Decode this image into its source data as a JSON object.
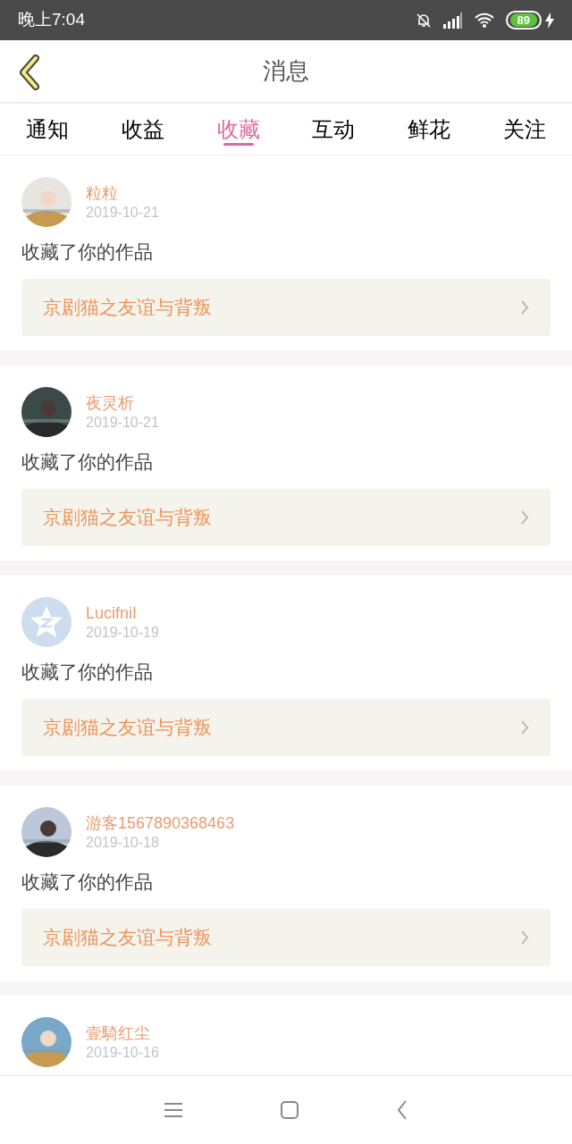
{
  "status_bar": {
    "time": "晚上7:04",
    "battery": "89"
  },
  "header": {
    "title": "消息"
  },
  "tabs": [
    {
      "label": "通知",
      "selected": false
    },
    {
      "label": "收益",
      "selected": false
    },
    {
      "label": "收藏",
      "selected": true
    },
    {
      "label": "互动",
      "selected": false
    },
    {
      "label": "鲜花",
      "selected": false
    },
    {
      "label": "关注",
      "selected": false
    }
  ],
  "messages": [
    {
      "name": "粒粒",
      "date": "2019-10-21",
      "text": "收藏了你的作品",
      "work": "京剧猫之友谊与背叛"
    },
    {
      "name": "夜灵析",
      "date": "2019-10-21",
      "text": "收藏了你的作品",
      "work": "京剧猫之友谊与背叛"
    },
    {
      "avatar": {
        "kind": "icon"
      },
      "name": "LucifniI",
      "date": "2019-10-19",
      "text": "收藏了你的作品",
      "work": "京剧猫之友谊与背叛"
    },
    {
      "name": "游客1567890368463",
      "date": "2019-10-18",
      "text": "收藏了你的作品",
      "work": "京剧猫之友谊与背叛"
    },
    {
      "name": "壹騎红尘",
      "date": "2019-10-16"
    }
  ]
}
